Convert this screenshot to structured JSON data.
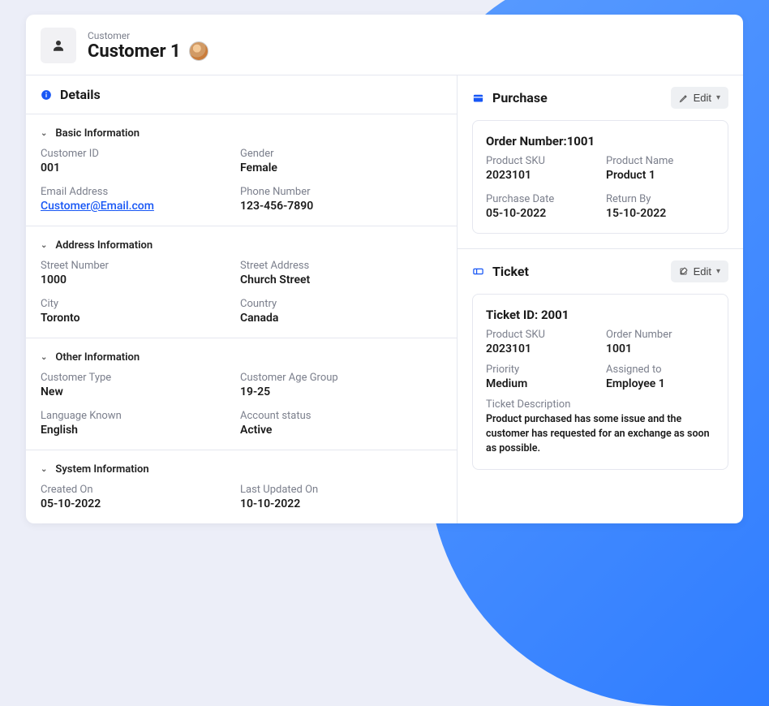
{
  "header": {
    "entity_label": "Customer",
    "entity_name": "Customer 1"
  },
  "details": {
    "title": "Details",
    "basic": {
      "title": "Basic Information",
      "customer_id_label": "Customer ID",
      "customer_id": "001",
      "gender_label": "Gender",
      "gender": "Female",
      "email_label": "Email Address",
      "email": "Customer@Email.com",
      "phone_label": "Phone Number",
      "phone": "123-456-7890"
    },
    "address": {
      "title": "Address Information",
      "street_number_label": "Street Number",
      "street_number": "1000",
      "street_address_label": "Street Address",
      "street_address": "Church Street",
      "city_label": "City",
      "city": "Toronto",
      "country_label": "Country",
      "country": "Canada"
    },
    "other": {
      "title": "Other Information",
      "customer_type_label": "Customer Type",
      "customer_type": "New",
      "age_group_label": "Customer Age Group",
      "age_group": "19-25",
      "language_label": "Language Known",
      "language": "English",
      "status_label": "Account status",
      "status": "Active"
    },
    "system": {
      "title": "System Information",
      "created_label": "Created On",
      "created": "05-10-2022",
      "updated_label": "Last Updated On",
      "updated": "10-10-2022"
    }
  },
  "purchase": {
    "title": "Purchase",
    "edit_label": "Edit",
    "order_number_label": "Order Number:",
    "order_number": "1001",
    "sku_label": "Product SKU",
    "sku": "2023101",
    "product_name_label": "Product Name",
    "product_name": "Product 1",
    "purchase_date_label": "Purchase Date",
    "purchase_date": "05-10-2022",
    "return_by_label": "Return By",
    "return_by": "15-10-2022"
  },
  "ticket": {
    "title": "Ticket",
    "edit_label": "Edit",
    "ticket_id_label": "Ticket ID: ",
    "ticket_id": "2001",
    "sku_label": "Product SKU",
    "sku": "2023101",
    "order_number_label": "Order Number",
    "order_number": "1001",
    "priority_label": "Priority",
    "priority": "Medium",
    "assigned_label": "Assigned to",
    "assigned": "Employee 1",
    "description_label": "Ticket Description",
    "description": "Product purchased has some issue and the customer has requested for an exchange as soon as possible."
  }
}
